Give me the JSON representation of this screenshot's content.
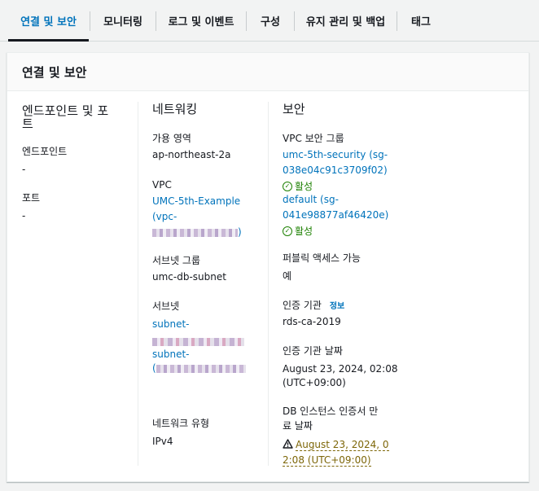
{
  "tabs": [
    {
      "label": "연결 및 보안",
      "active": true
    },
    {
      "label": "모니터링"
    },
    {
      "label": "로그 및 이벤트"
    },
    {
      "label": "구성"
    },
    {
      "label": "유지 관리 및 백업"
    },
    {
      "label": "태그"
    }
  ],
  "panel": {
    "title": "연결 및 보안"
  },
  "endpoints": {
    "title_line1": "엔드포인트 및 포",
    "title_line2": "트",
    "endpoint_label": "엔드포인트",
    "endpoint_value": "-",
    "port_label": "포트",
    "port_value": "-"
  },
  "networking": {
    "title": "네트워킹",
    "az_label": "가용 영역",
    "az_value": "ap-northeast-2a",
    "vpc_label": "VPC",
    "vpc_link_line1": "UMC-5th-Example",
    "vpc_link_line2": "(vpc-",
    "vpc_link_end": ")",
    "subnet_group_label": "서브넷 그룹",
    "subnet_group_value": "umc-db-subnet",
    "subnets_label": "서브넷",
    "subnet1_prefix": "subnet-",
    "subnet2_prefix": "subnet-",
    "subnet2_open": "(",
    "network_type_label": "네트워크 유형",
    "network_type_value": "IPv4"
  },
  "security": {
    "title": "보안",
    "sg_label": "VPC 보안 그룹",
    "sg1_line1": "umc-5th-security (sg-",
    "sg1_line2": "038e04c91c3709f02)",
    "sg1_status": "활성",
    "sg2_line1": "default (sg-",
    "sg2_line2": "041e98877af46420e)",
    "sg2_status": "활성",
    "public_label": "퍼블릭 액세스 가능",
    "public_value": "예",
    "ca_label": "인증 기관",
    "ca_info": "정보",
    "ca_value": "rds-ca-2019",
    "ca_date_label": "인증 기관 날짜",
    "ca_date_line1": "August 23, 2024, 02:08",
    "ca_date_line2": "(UTC+09:00)",
    "cert_expiry_label_line1": "DB 인스턴스 인증서 만",
    "cert_expiry_label_line2": "료 날짜",
    "cert_expiry_line1": "August 23, 2024, 0",
    "cert_expiry_line2": "2:08 (UTC+09:00)"
  },
  "colors": {
    "accent": "#0073bb",
    "success": "#1d8102",
    "warning": "#7d6608"
  }
}
